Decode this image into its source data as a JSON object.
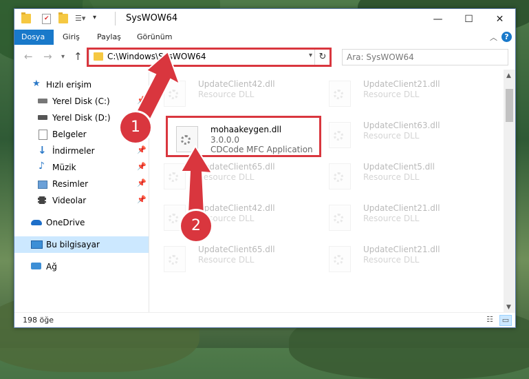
{
  "window": {
    "title": "SysWOW64"
  },
  "ribbon_tabs": [
    "Dosya",
    "Giriş",
    "Paylaş",
    "Görünüm"
  ],
  "address": {
    "path": "C:\\Windows\\SysWOW64",
    "search_placeholder": "Ara: SysWOW64"
  },
  "sidebar": {
    "items": [
      {
        "label": "Hızlı erişim",
        "icon": "star-icon"
      },
      {
        "label": "Yerel Disk (C:)",
        "icon": "drive-icon"
      },
      {
        "label": "Yerel Disk (D:)",
        "icon": "drive-icon"
      },
      {
        "label": "Belgeler",
        "icon": "documents-icon"
      },
      {
        "label": "İndirmeler",
        "icon": "download-icon"
      },
      {
        "label": "Müzik",
        "icon": "music-icon"
      },
      {
        "label": "Resimler",
        "icon": "pictures-icon"
      },
      {
        "label": "Videolar",
        "icon": "video-icon"
      },
      {
        "label": "OneDrive",
        "icon": "cloud-icon"
      },
      {
        "label": "Bu bilgisayar",
        "icon": "computer-icon"
      },
      {
        "label": "Ağ",
        "icon": "network-icon"
      }
    ]
  },
  "files": {
    "highlighted": {
      "name": "mohaakeygen.dll",
      "version": "3.0.0.0",
      "description": "CDCode MFC Application"
    },
    "faded": [
      {
        "name": "UpdateClient42.dll",
        "type": "Resource DLL"
      },
      {
        "name": "UpdateClient21.dll",
        "type": "Resource DLL"
      },
      {
        "name": "UpdateClient63.dll",
        "type": "Resource DLL"
      },
      {
        "name": "UpdateClient65.dll",
        "type": "Resource DLL"
      },
      {
        "name": "UpdateClient5.dll",
        "type": "Resource DLL"
      },
      {
        "name": "UpdateClient42.dll",
        "type": "Resource DLL"
      },
      {
        "name": "UpdateClient21.dll",
        "type": "Resource DLL"
      },
      {
        "name": "UpdateClient65.dll",
        "type": "Resource DLL"
      },
      {
        "name": "UpdateClient21.dll",
        "type": "Resource DLL"
      }
    ]
  },
  "status": {
    "item_count": "198 öğe"
  },
  "annotations": {
    "step1": "1",
    "step2": "2",
    "color": "#d9363e"
  },
  "colors": {
    "accent": "#1979ca",
    "selection": "#cce8ff"
  }
}
